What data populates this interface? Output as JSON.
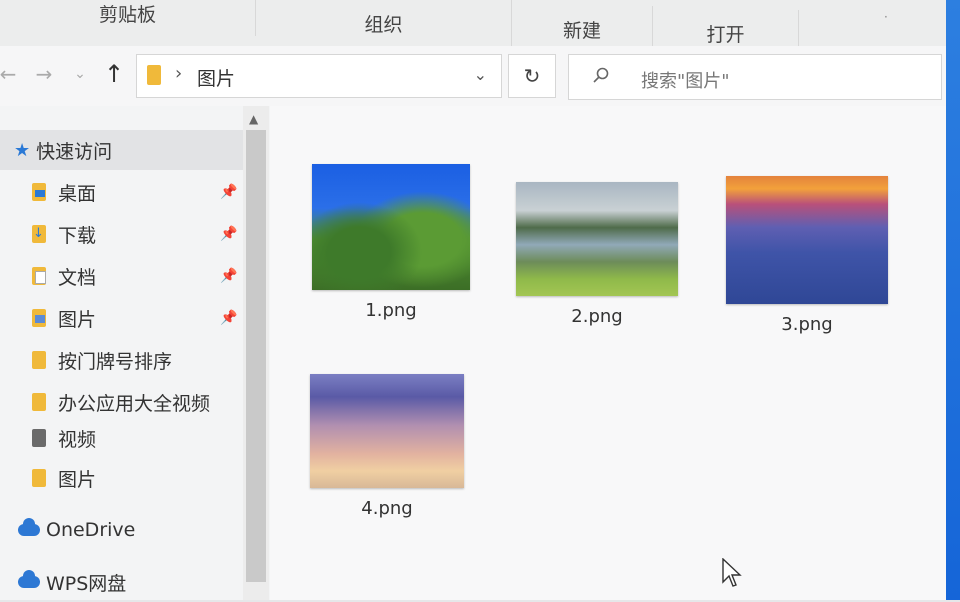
{
  "ribbon": {
    "groups": [
      "剪贴板",
      "组织",
      "新建",
      "打开"
    ]
  },
  "toolbar": {
    "back_icon": "←",
    "forward_icon": "→",
    "recent_icon": "⌄",
    "up_icon": "↑",
    "refresh_icon": "↻"
  },
  "address": {
    "separator": "›",
    "path": "图片",
    "dropdown_icon": "⌄"
  },
  "search": {
    "placeholder": "搜索\"图片\""
  },
  "sidebar": {
    "quick_access": "快速访问",
    "items": [
      {
        "label": "桌面",
        "icon": "desktop-folder-icon",
        "pinned": true
      },
      {
        "label": "下载",
        "icon": "download-folder-icon",
        "pinned": true
      },
      {
        "label": "文档",
        "icon": "document-folder-icon",
        "pinned": true
      },
      {
        "label": "图片",
        "icon": "pictures-folder-icon",
        "pinned": true
      },
      {
        "label": "按门牌号排序",
        "icon": "folder-icon",
        "pinned": false
      },
      {
        "label": "办公应用大全视频",
        "icon": "folder-icon",
        "pinned": false
      },
      {
        "label": "视频",
        "icon": "video-folder-icon",
        "pinned": false
      },
      {
        "label": "图片",
        "icon": "folder-icon",
        "pinned": false
      }
    ],
    "onedrive": "OneDrive",
    "wps": "WPS网盘",
    "pin_icon": "📌"
  },
  "files": [
    {
      "name": "1.png"
    },
    {
      "name": "2.png"
    },
    {
      "name": "3.png"
    },
    {
      "name": "4.png"
    }
  ]
}
